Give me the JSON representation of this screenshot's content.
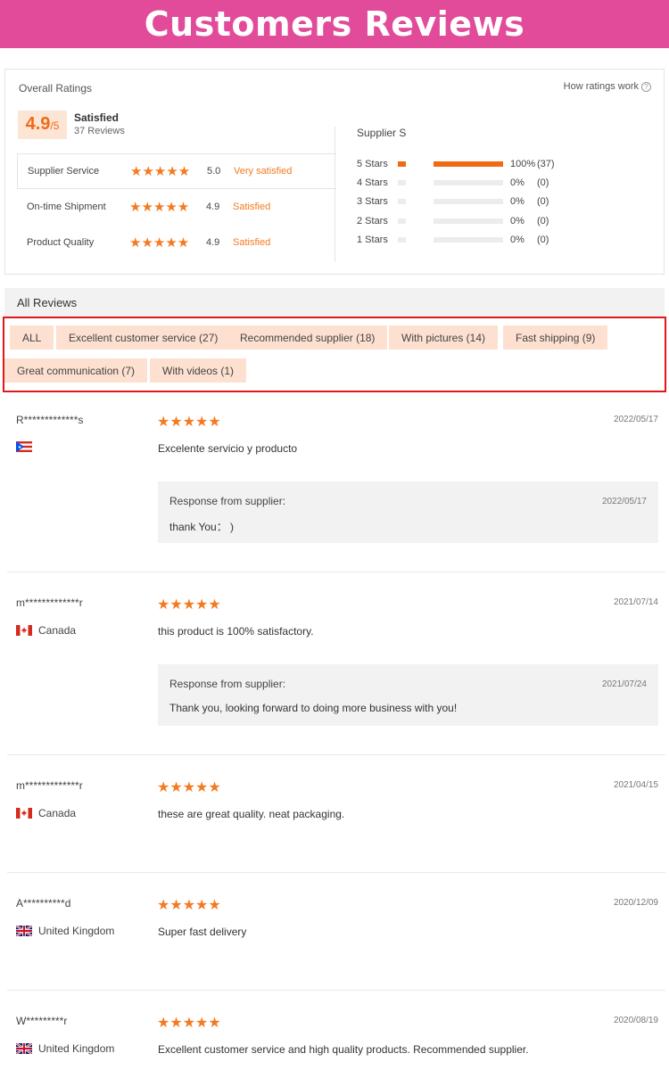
{
  "banner": {
    "title": "Customers Reviews"
  },
  "overall": {
    "label": "Overall Ratings",
    "how_link": "How ratings work",
    "score": "4.9",
    "score_max": "/5",
    "satisfaction": "Satisfied",
    "reviews_count": "37 Reviews",
    "metrics": [
      {
        "name": "Supplier Service",
        "stars": "★★★★★",
        "score": "5.0",
        "status": "Very satisfied"
      },
      {
        "name": "On-time Shipment",
        "stars": "★★★★★",
        "score": "4.9",
        "status": "Satisfied"
      },
      {
        "name": "Product Quality",
        "stars": "★★★★★",
        "score": "4.9",
        "status": "Satisfied"
      }
    ],
    "supplier_label": "Supplier Service",
    "distribution": [
      {
        "label": "5 Stars",
        "fraction": 1.0,
        "percent": "100%",
        "count": "(37)"
      },
      {
        "label": "4 Stars",
        "fraction": 0,
        "percent": "0%",
        "count": "(0)"
      },
      {
        "label": "3 Stars",
        "fraction": 0,
        "percent": "0%",
        "count": "(0)"
      },
      {
        "label": "2 Stars",
        "fraction": 0,
        "percent": "0%",
        "count": "(0)"
      },
      {
        "label": "1 Stars",
        "fraction": 0,
        "percent": "0%",
        "count": "(0)"
      }
    ]
  },
  "all_reviews": {
    "title": "All Reviews",
    "filters": [
      "ALL",
      "Excellent customer service (27)",
      "Recommended supplier (18)",
      "With pictures (14)",
      "Fast shipping (9)",
      "Great communication (7)",
      "With videos (1)"
    ]
  },
  "reviews": [
    {
      "name": "R*************s",
      "country": "",
      "flag": "puerto-rico-flag",
      "stars": "★★★★★",
      "date": "2022/05/17",
      "text": "Excelente servicio y producto",
      "response": {
        "label": "Response from supplier:",
        "date": "2022/05/17",
        "text": "thank You： )"
      }
    },
    {
      "name": "m*************r",
      "country": "Canada",
      "flag": "canada-flag",
      "stars": "★★★★★",
      "date": "2021/07/14",
      "text": "this product is 100% satisfactory.",
      "response": {
        "label": "Response from supplier:",
        "date": "2021/07/24",
        "text": "Thank you, looking forward to doing more business with you!"
      }
    },
    {
      "name": "m*************r",
      "country": "Canada",
      "flag": "canada-flag",
      "stars": "★★★★★",
      "date": "2021/04/15",
      "text": "these are great quality. neat packaging."
    },
    {
      "name": "A**********d",
      "country": "United Kingdom",
      "flag": "uk-flag",
      "stars": "★★★★★",
      "date": "2020/12/09",
      "text": "Super fast delivery"
    },
    {
      "name": "W*********r",
      "country": "United Kingdom",
      "flag": "uk-flag",
      "stars": "★★★★★",
      "date": "2020/08/19",
      "text": "Excellent customer service and high quality products. Recommended supplier."
    }
  ],
  "colors": {
    "banner": "#e14b9a",
    "accent": "#f06a15",
    "chip_bg": "#fde0d0",
    "highlight_border": "#e01818"
  }
}
